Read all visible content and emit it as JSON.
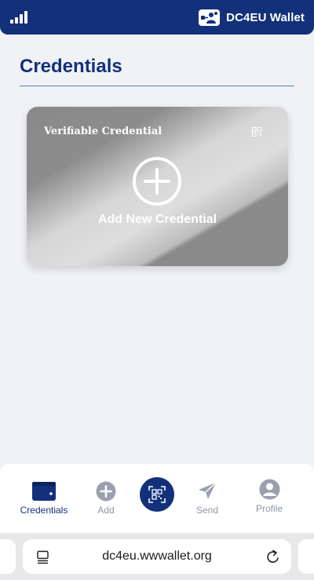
{
  "header": {
    "app_name": "DC4EU Wallet",
    "background_color": "#13307a",
    "signal_icon": "signal-bars-icon",
    "logo_icon": "dc4eu-logo-icon"
  },
  "page": {
    "title": "Credentials",
    "accent_color": "#13307a"
  },
  "add_card": {
    "card_title": "Verifiable Credential",
    "action_label": "Add New Credential",
    "plus_icon": "plus-circle-icon",
    "qr_icon": "qr-code-icon"
  },
  "bottom_nav": {
    "items": [
      {
        "label": "Credentials",
        "icon": "wallet-icon",
        "active": true
      },
      {
        "label": "Add",
        "icon": "add-circle-icon",
        "active": false
      },
      {
        "label": "Send",
        "icon": "send-icon",
        "active": false
      },
      {
        "label": "Profile",
        "icon": "profile-icon",
        "active": false
      }
    ],
    "scan_icon": "qr-scan-icon"
  },
  "browser": {
    "url": "dc4eu.wwwallet.org",
    "menu_icon": "page-menu-icon",
    "reload_icon": "reload-icon"
  }
}
